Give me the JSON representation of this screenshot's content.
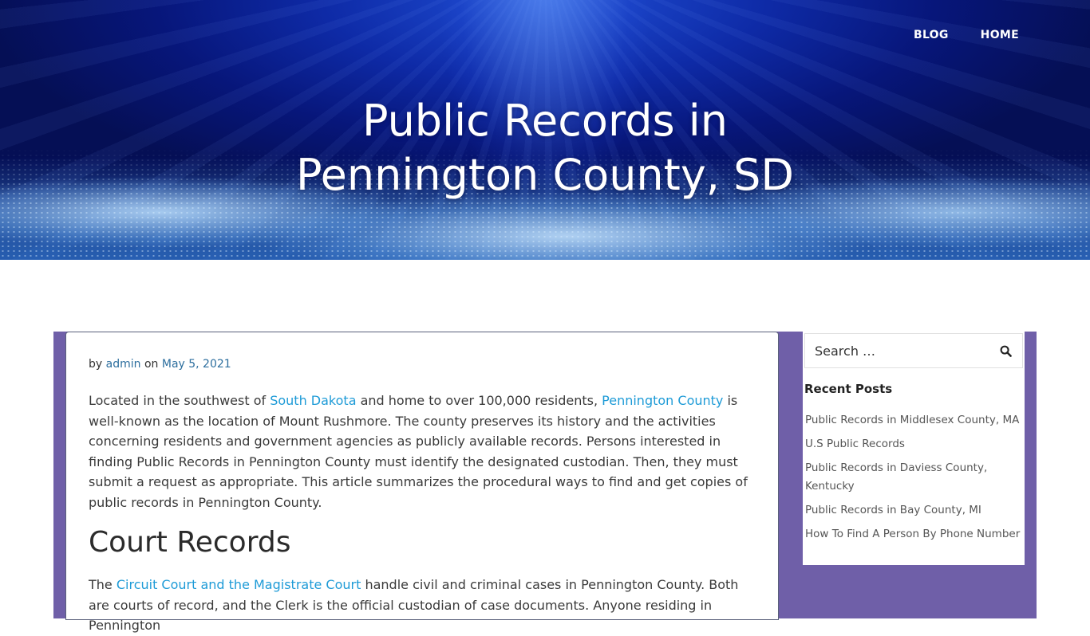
{
  "nav": {
    "items": [
      "BLOG",
      "HOME"
    ]
  },
  "hero": {
    "title_line1": "Public Records in",
    "title_line2": "Pennington County, SD"
  },
  "meta": {
    "by": "by",
    "author": "admin",
    "on": "on",
    "date": "May 5, 2021"
  },
  "intro": {
    "t1": "Located in the southwest of ",
    "link1": "South Dakota",
    "t2": " and home to over 100,000 residents, ",
    "link2": "Pennington County",
    "t3": " is well-known as the location of Mount Rushmore. The county preserves its history and the activities concerning residents and government agencies as publicly available records. Persons interested in finding Public Records in Pennington County must identify the designated custodian. Then, they must submit a request as appropriate. This article summarizes the procedural ways to find and get copies of public records in Pennington County."
  },
  "court": {
    "heading": "Court Records",
    "t1": "The ",
    "link": "Circuit Court and the Magistrate Court",
    "t2": " handle civil and criminal cases in Pennington County. Both are courts of record, and the Clerk is the official custodian of case documents. Anyone residing in Pennington"
  },
  "sidebar": {
    "search_placeholder": "Search …",
    "recent_title": "Recent Posts",
    "recent_posts": [
      "Public Records in Middlesex County, MA",
      "U.S Public Records",
      "Public Records in Daviess County, Kentucky",
      "Public Records in Bay County, MI",
      "How To Find A Person By Phone Number"
    ]
  },
  "colors": {
    "band": "#6f5fa8",
    "link": "#1e9bd7",
    "meta_link": "#2c6e9e"
  }
}
